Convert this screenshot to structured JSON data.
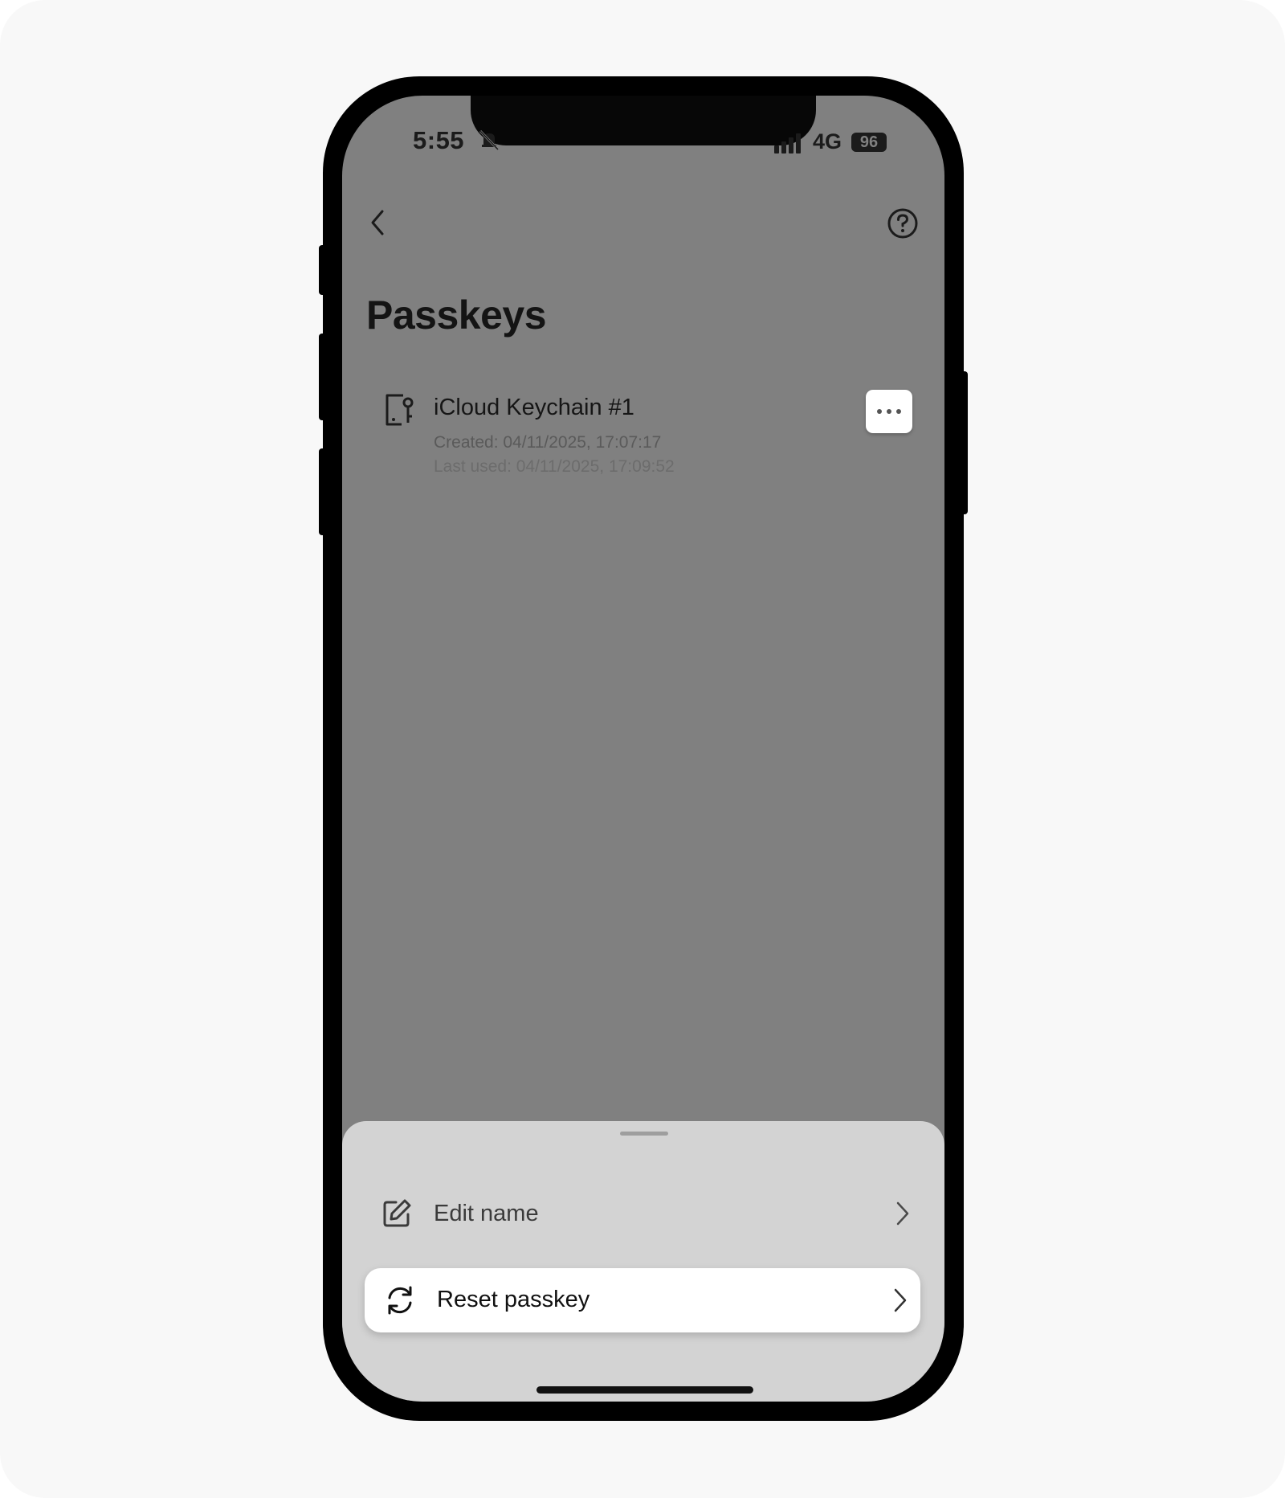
{
  "status_bar": {
    "time": "5:55",
    "network": "4G",
    "battery": "96"
  },
  "header": {
    "title": "Passkeys",
    "back_icon": "chevron-left-icon",
    "help_icon": "question-circle-icon"
  },
  "passkeys": [
    {
      "name": "iCloud Keychain #1",
      "created": "Created: 04/11/2025, 17:07:17",
      "last_used": "Last used: 04/11/2025, 17:09:52",
      "icon": "device-key-icon"
    }
  ],
  "action_sheet": {
    "items": [
      {
        "label": "Edit name",
        "icon": "edit-icon"
      },
      {
        "label": "Reset passkey",
        "icon": "refresh-icon"
      }
    ]
  },
  "colors": {
    "dimmed_background": "#808080",
    "sheet_background": "#d3d3d3",
    "highlight_background": "#ffffff",
    "phone_frame": "#000000"
  }
}
